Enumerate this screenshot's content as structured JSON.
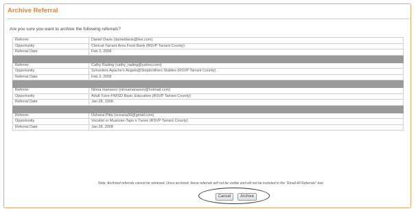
{
  "dialog": {
    "title": "Archive Referral",
    "question": "Are you sure you want to archive the following referrals?",
    "note": "Note: Archived referrals cannot be retrieved. Once archived, these referrals will not be visible and will not be included in the \"Email All Referrals\" tool.",
    "cancel_label": "Cancel",
    "archive_label": "Archive"
  },
  "labels": {
    "referrer": "Referrer",
    "opportunity": "Opportunity",
    "date": "Referral Date"
  },
  "referrals": [
    {
      "referrer": "Daniel Davis (danieldavis@live.com)",
      "opportunity": "Clerical-Tarrant Area Food Bank (RSVP Tarrant County)",
      "date": "Feb 3, 2008"
    },
    {
      "referrer": "Cathy Rading (cathy_rading@yahoo.com)",
      "opportunity": "Schoolers-Apache's Angels@Stepbrothers Stables (RSVP Tarrant County)",
      "date": "Feb 3, 2008"
    },
    {
      "referrer": "Ninna manason (ninnamanason@hotmail.com)",
      "opportunity": "Adult Tutor-FWISD Basic Education (RSVP Tarrant County)",
      "date": "Jan 28, 2008"
    },
    {
      "referrer": "Oshena Pitts (oceana30@gmail.com)",
      "opportunity": "Vocalist or Musician-Taps n Tunes (RSVP Tarrant County)",
      "date": "Jan 28, 2008"
    }
  ]
}
